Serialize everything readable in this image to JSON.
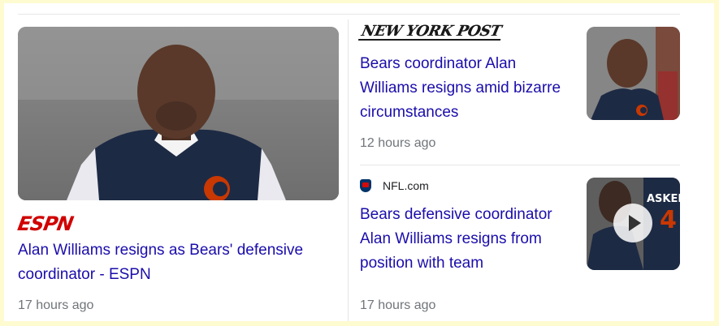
{
  "hero": {
    "source": "ESPN",
    "title": "Alan Williams resigns as Bears' defensive coordinator - ESPN",
    "time": "17 hours ago"
  },
  "card1": {
    "source": "NEW YORK POST",
    "title": "Bears coordinator Alan Williams resigns amid bizarre circumstances",
    "time": "12 hours ago"
  },
  "card2": {
    "source": "NFL.com",
    "title": "Bears defensive coordinator Alan Williams resigns from position with team",
    "time": "17 hours ago",
    "jersey_text": "ASKER"
  },
  "colors": {
    "link": "#1a0dab",
    "timestamp": "#70757a",
    "espn_red": "#d00000",
    "bears_navy": "#1d2a44",
    "bears_orange": "#c83803"
  },
  "icons": [
    "espn-logo",
    "new-york-post-logo",
    "nfl-shield-icon",
    "play-icon"
  ]
}
